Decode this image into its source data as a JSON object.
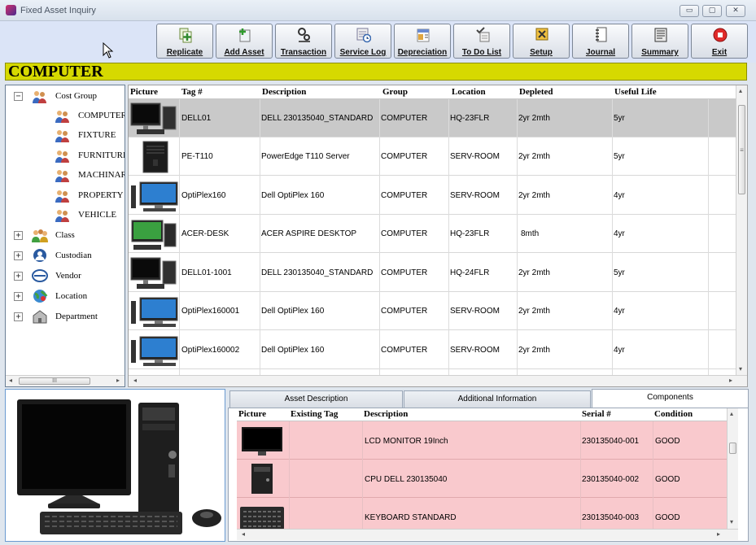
{
  "window": {
    "title": "Fixed Asset Inquiry",
    "min_glyph": "▭",
    "max_glyph": "▢",
    "close_glyph": "✕"
  },
  "toolbar": [
    {
      "label": "Replicate",
      "icon": "replicate-icon"
    },
    {
      "label": "Add Asset",
      "icon": "add-asset-icon"
    },
    {
      "label": "Transaction",
      "icon": "transaction-icon"
    },
    {
      "label": "Service Log",
      "icon": "service-log-icon"
    },
    {
      "label": "Depreciation",
      "icon": "depreciation-icon"
    },
    {
      "label": "To Do List",
      "icon": "todo-icon"
    },
    {
      "label": "Setup",
      "icon": "setup-icon"
    },
    {
      "label": "Journal",
      "icon": "journal-icon"
    },
    {
      "label": "Summary",
      "icon": "summary-icon"
    },
    {
      "label": "Exit",
      "icon": "exit-icon"
    }
  ],
  "header_band": "COMPUTER",
  "tree": {
    "root": "Cost Group",
    "children": [
      "COMPUTER",
      "FIXTURE",
      "FURNITURE",
      "MACHINARY",
      "PROPERTY",
      "VEHICLE"
    ],
    "others": [
      "Class",
      "Custodian",
      "Vendor",
      "Location",
      "Department"
    ],
    "expand_glyph": "+",
    "collapse_glyph": "−",
    "scroll_grip": "III"
  },
  "grid": {
    "columns": [
      "Picture",
      "Tag #",
      "Description",
      "Group",
      "Location",
      "Depleted",
      "Useful Life"
    ],
    "rows": [
      {
        "tag": "DELL01",
        "description": "DELL 230135040_STANDARD",
        "group": "COMPUTER",
        "location": "HQ-23FLR",
        "depleted": "2yr 2mth",
        "life": "5yr",
        "picture": "desktop-monitor-tower"
      },
      {
        "tag": "PE-T110",
        "description": "PowerEdge T110 Server",
        "group": "COMPUTER",
        "location": "SERV-ROOM",
        "depleted": "2yr 2mth",
        "life": "5yr",
        "picture": "server-tower"
      },
      {
        "tag": "OptiPlex160",
        "description": "Dell OptiPlex 160",
        "group": "COMPUTER",
        "location": "SERV-ROOM",
        "depleted": "2yr 2mth",
        "life": "4yr",
        "picture": "widescreen-desktop"
      },
      {
        "tag": "ACER-DESK",
        "description": "ACER ASPIRE DESKTOP",
        "group": "COMPUTER",
        "location": "HQ-23FLR",
        "depleted": "8mth",
        "life": "4yr",
        "picture": "acer-desktop"
      },
      {
        "tag": "DELL01-1001",
        "description": "DELL 230135040_STANDARD",
        "group": "COMPUTER",
        "location": "HQ-24FLR",
        "depleted": "2yr 2mth",
        "life": "5yr",
        "picture": "desktop-monitor-tower"
      },
      {
        "tag": "OptiPlex160001",
        "description": "Dell OptiPlex 160",
        "group": "COMPUTER",
        "location": "SERV-ROOM",
        "depleted": "2yr 2mth",
        "life": "4yr",
        "picture": "widescreen-desktop"
      },
      {
        "tag": "OptiPlex160002",
        "description": "Dell OptiPlex 160",
        "group": "COMPUTER",
        "location": "SERV-ROOM",
        "depleted": "2yr 2mth",
        "life": "4yr",
        "picture": "widescreen-desktop"
      }
    ],
    "scroll_grip": "≡",
    "selected_index": 0
  },
  "tabs": [
    "Asset Description",
    "Additional Information",
    "Components"
  ],
  "active_tab": 2,
  "components": {
    "columns": [
      "Picture",
      "Existing Tag",
      "Description",
      "Serial #",
      "Condition"
    ],
    "rows": [
      {
        "existing_tag": "",
        "description": "LCD MONITOR 19Inch",
        "serial": "230135040-001",
        "condition": "GOOD",
        "picture": "monitor"
      },
      {
        "existing_tag": "",
        "description": "CPU DELL 230135040",
        "serial": "230135040-002",
        "condition": "GOOD",
        "picture": "cpu-tower"
      },
      {
        "existing_tag": "",
        "description": "KEYBOARD STANDARD",
        "serial": "230135040-003",
        "condition": "GOOD",
        "picture": "keyboard"
      }
    ]
  },
  "colors": {
    "header_band": "#d6d900",
    "selected_row": "#c9c9c9",
    "component_row": "#f9c9cd",
    "toolbar_bg": "#dbe4f7"
  }
}
